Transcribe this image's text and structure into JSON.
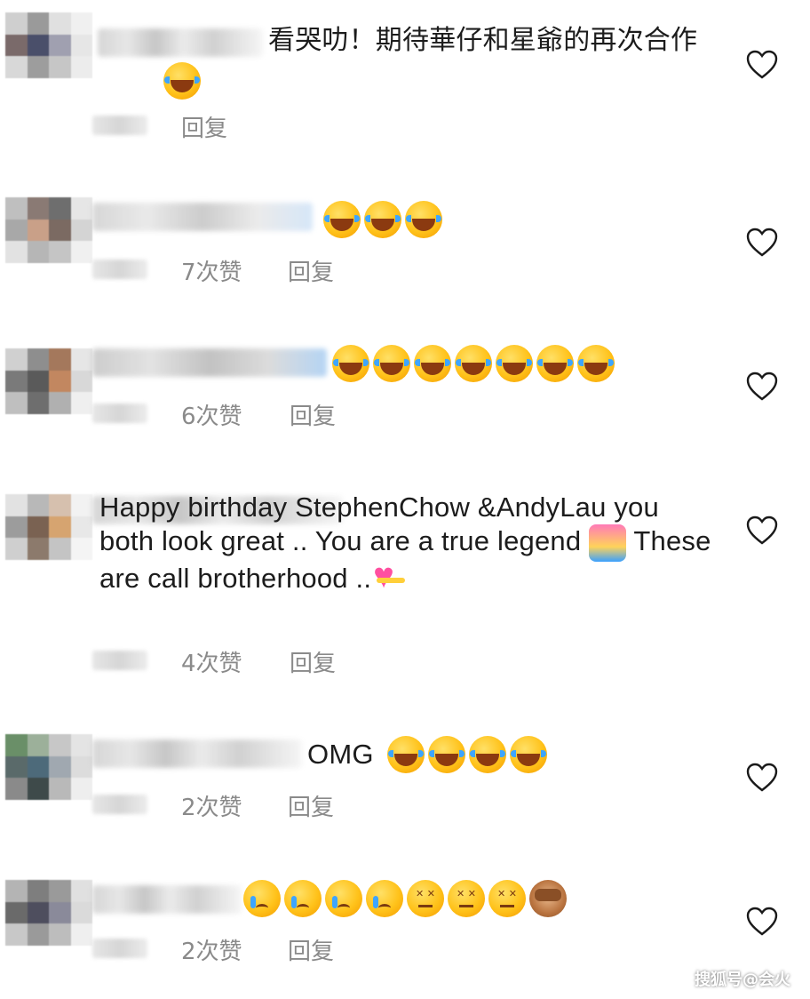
{
  "comments": [
    {
      "text": "看哭叻！期待華仔和星爺的再次合作",
      "emojis": [
        "laugh"
      ],
      "likes": "",
      "reply": "回复"
    },
    {
      "text": "",
      "emojis": [
        "laugh",
        "laugh",
        "laugh"
      ],
      "likes": "7次赞",
      "reply": "回复"
    },
    {
      "text": "",
      "emojis": [
        "laugh",
        "laugh",
        "laugh",
        "laugh",
        "laugh",
        "laugh",
        "laugh"
      ],
      "likes": "6次赞",
      "reply": "回复"
    },
    {
      "text": "Happy birthday StephenChow &AndyLau you both look great .. You are a true legend",
      "text_2": "These are call brotherhood ..",
      "emojis": [
        "couple",
        "heart"
      ],
      "likes": "4次赞",
      "reply": "回复"
    },
    {
      "text": "OMG",
      "emojis": [
        "laugh",
        "laugh",
        "laugh",
        "laugh"
      ],
      "likes": "2次赞",
      "reply": "回复"
    },
    {
      "text": "",
      "emojis": [
        "cry",
        "cry",
        "cry",
        "cry",
        "angry",
        "angry",
        "angry",
        "monkey"
      ],
      "likes": "2次赞",
      "reply": "回复"
    }
  ],
  "colors": {
    "heart": "#1a1a1a",
    "meta": "#8a8a8a",
    "blur": "#d4d4d4"
  },
  "watermark": "搜狐号@会火"
}
